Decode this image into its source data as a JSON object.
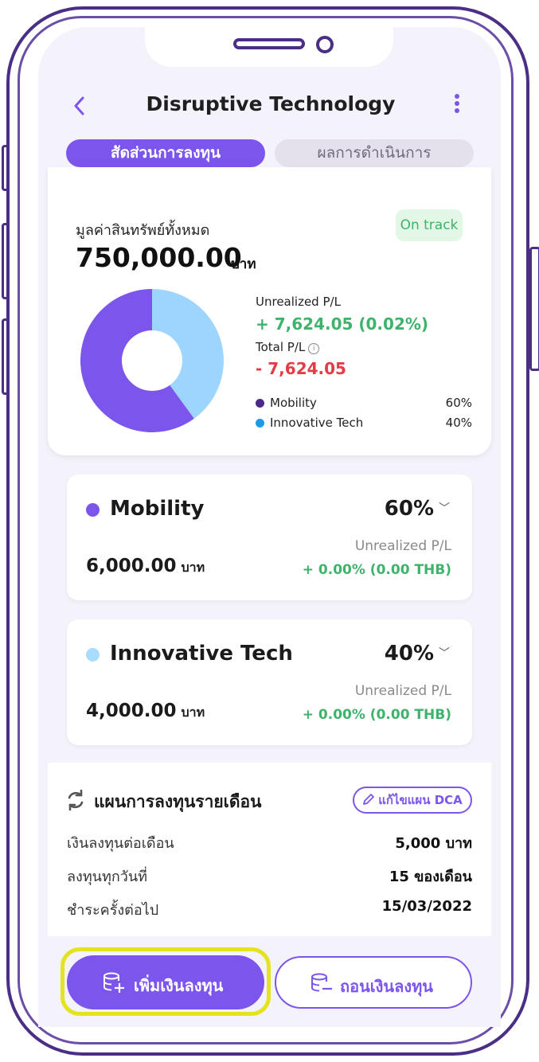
{
  "header": {
    "title": "Disruptive Technology"
  },
  "tabs": [
    {
      "label": "สัดส่วนการลงทุน",
      "active": true
    },
    {
      "label": "ผลการดำเนินการ",
      "active": false
    }
  ],
  "summary": {
    "total_label": "มูลค่าสินทรัพย์ทั้งหมด",
    "total_value": "750,000.00",
    "total_unit": "บาท",
    "status_badge": "On track",
    "unrealized_label": "Unrealized P/L",
    "unrealized_value": "+ 7,624.05 (0.02%)",
    "total_pl_label": "Total P/L",
    "total_pl_value": "- 7,624.05",
    "colors": {
      "positive": "#3fb26b",
      "negative": "#e43b45",
      "accent": "#7c55ec"
    }
  },
  "chart_data": {
    "type": "pie",
    "donut": true,
    "categories": [
      "Mobility",
      "Innovative Tech"
    ],
    "values": [
      60,
      40
    ],
    "colors": [
      "#7c55ec",
      "#9ed5ff"
    ]
  },
  "legend": [
    {
      "name": "Mobility",
      "pct": "60%",
      "color": "#4b2a8a"
    },
    {
      "name": "Innovative Tech",
      "pct": "40%",
      "color": "#1e9be6"
    }
  ],
  "allocations": [
    {
      "name": "Mobility",
      "pct": "60%",
      "amount": "6,000.00",
      "unit": "บาท",
      "pl_label": "Unrealized P/L",
      "pl_value": "+ 0.00% (0.00 THB)",
      "color": "#7c55ec"
    },
    {
      "name": "Innovative Tech",
      "pct": "40%",
      "amount": "4,000.00",
      "unit": "บาท",
      "pl_label": "Unrealized P/L",
      "pl_value": "+ 0.00% (0.00 THB)",
      "color": "#a9dcff"
    }
  ],
  "dca": {
    "title": "แผนการลงทุนรายเดือน",
    "edit_label": "แก้ไขแผน DCA",
    "rows": [
      {
        "label": "เงินลงทุนต่อเดือน",
        "value": "5,000 บาท"
      },
      {
        "label": "ลงทุนทุกวันที่",
        "value": "15 ของเดือน"
      },
      {
        "label": "ชำระครั้งต่อไป",
        "value": "15/03/2022"
      }
    ]
  },
  "actions": {
    "invest_label": "เพิ่มเงินลงทุน",
    "withdraw_label": "ถอนเงินลงทุน"
  }
}
